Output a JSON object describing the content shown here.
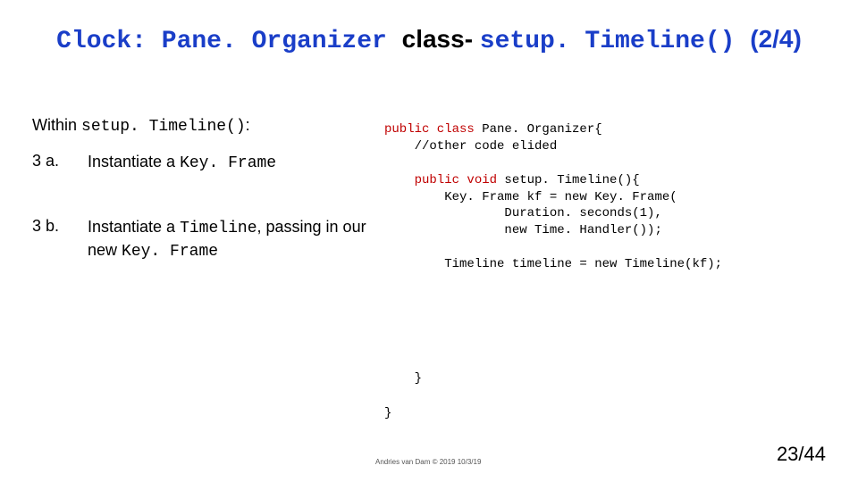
{
  "title": {
    "prefix": "Clock: Pane. Organizer ",
    "mid_black": "class- ",
    "method": "setup. Timeline() ",
    "suffix": "(2/4)"
  },
  "intro": {
    "within": "Within ",
    "method": "setup. Timeline()",
    "colon": ":"
  },
  "steps": {
    "a": {
      "num": "3 a.",
      "pre": "Instantiate a  ",
      "code": "Key. Frame"
    },
    "b": {
      "num": "3 b.",
      "pre1": "Instantiate a ",
      "code1": "Timeline",
      "mid": ", passing in our new ",
      "code2": "Key. Frame"
    }
  },
  "code": {
    "l1a": "public class ",
    "l1b": "Pane. Organizer{",
    "l2": "    //other code elided",
    "l3": "",
    "l4a": "    public void ",
    "l4b": "setup. Timeline(){",
    "l5": "        Key. Frame kf = new Key. Frame(",
    "l6": "                Duration. seconds(1),",
    "l7": "                new Time. Handler());",
    "l8": "",
    "l9": "        Timeline timeline = new Timeline(kf);",
    "close1": "    }",
    "close2": "}"
  },
  "footer": {
    "copyright": "Andries van Dam © 2019 10/3/19",
    "page": "23/44"
  }
}
